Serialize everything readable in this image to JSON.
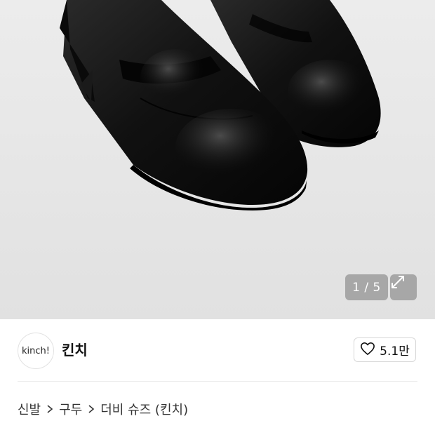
{
  "gallery": {
    "counter": "1 / 5",
    "expand_icon": "expand-icon"
  },
  "store": {
    "logo_text": "kinch!",
    "name": "킨치",
    "like_icon": "heart-outline-icon",
    "like_count": "5.1만"
  },
  "breadcrumb": {
    "items": [
      "신발",
      "구두",
      "더비 슈즈 (킨치)"
    ],
    "separator_icon": "chevron-right-icon"
  },
  "colors": {
    "hero_bg": "#e6e6e6",
    "overlay_badge": "#969696",
    "text_primary": "#111111"
  }
}
